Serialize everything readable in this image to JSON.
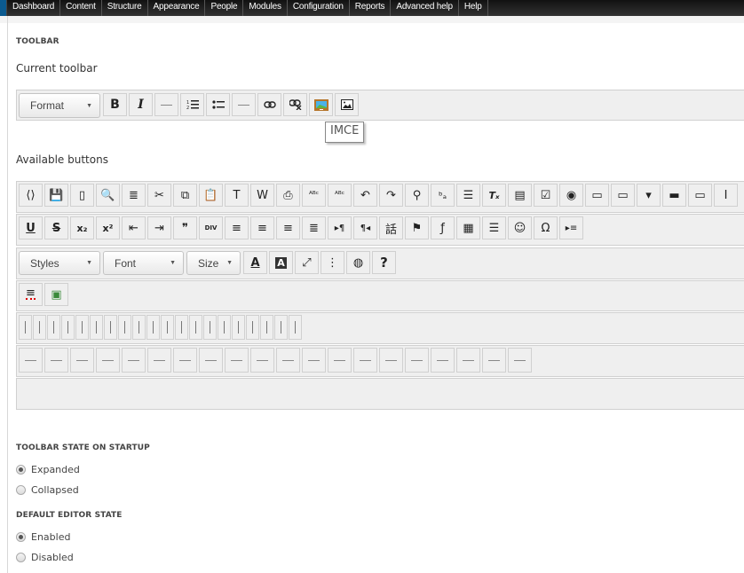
{
  "nav": {
    "items": [
      "Dashboard",
      "Content",
      "Structure",
      "Appearance",
      "People",
      "Modules",
      "Configuration",
      "Reports",
      "Advanced help",
      "Help"
    ]
  },
  "toolbar_section": {
    "title": "TOOLBAR",
    "current_label": "Current toolbar",
    "current_buttons": [
      {
        "type": "combo",
        "label": "Format"
      },
      {
        "type": "button",
        "icon": "bold-icon",
        "glyph": "B"
      },
      {
        "type": "button",
        "icon": "italic-icon",
        "glyph": "I"
      },
      {
        "type": "button",
        "icon": "separator-icon",
        "glyph": "—"
      },
      {
        "type": "button",
        "icon": "numbered-list-icon",
        "glyph": "⒈"
      },
      {
        "type": "button",
        "icon": "bulleted-list-icon",
        "glyph": "•"
      },
      {
        "type": "button",
        "icon": "separator-icon",
        "glyph": "—"
      },
      {
        "type": "button",
        "icon": "link-icon",
        "glyph": "⚭"
      },
      {
        "type": "button",
        "icon": "unlink-icon",
        "glyph": "⚭"
      },
      {
        "type": "button",
        "icon": "imce-icon",
        "glyph": ""
      },
      {
        "type": "button",
        "icon": "image-icon",
        "glyph": ""
      }
    ],
    "tooltip": "IMCE",
    "available_label": "Available buttons",
    "available_row1": [
      "source-icon",
      "save-icon",
      "new-page-icon",
      "preview-icon",
      "templates-icon",
      "cut-icon",
      "copy-icon",
      "paste-icon",
      "paste-text-icon",
      "paste-word-icon",
      "print-icon",
      "spellcheck-icon",
      "scayt-icon",
      "undo-icon",
      "redo-icon",
      "find-icon",
      "replace-icon",
      "select-all-icon",
      "remove-format-icon",
      "form-icon",
      "checkbox-icon",
      "radio-icon",
      "text-field-icon",
      "textarea-icon",
      "select-icon",
      "button-icon",
      "image-button-icon",
      "hidden-field-icon"
    ],
    "available_row2": [
      "underline-icon",
      "strike-icon",
      "subscript-icon",
      "superscript-icon",
      "outdent-icon",
      "indent-icon",
      "blockquote-icon",
      "create-div-icon",
      "align-left-icon",
      "align-center-icon",
      "align-right-icon",
      "align-justify-icon",
      "ltr-icon",
      "rtl-icon",
      "language-icon",
      "anchor-icon",
      "flash-icon",
      "table-icon",
      "horizontal-rule-icon",
      "smiley-icon",
      "special-char-icon",
      "page-break-icon"
    ],
    "available_row3_combos": [
      "Styles",
      "Font",
      "Size"
    ],
    "available_row3": [
      "text-color-icon",
      "bg-color-icon",
      "maximize-icon",
      "show-blocks-icon",
      "iframe-icon",
      "about-icon"
    ],
    "available_row4": [
      "teaser-break-icon",
      "media-icon"
    ],
    "vertical_separator_count": 20,
    "horizontal_separator_count": 20
  },
  "startup_section": {
    "title": "TOOLBAR STATE ON STARTUP",
    "options": [
      {
        "label": "Expanded",
        "checked": true
      },
      {
        "label": "Collapsed",
        "checked": false
      }
    ]
  },
  "editor_section": {
    "title": "DEFAULT EDITOR STATE",
    "options": [
      {
        "label": "Enabled",
        "checked": true
      },
      {
        "label": "Disabled",
        "checked": false
      }
    ]
  }
}
